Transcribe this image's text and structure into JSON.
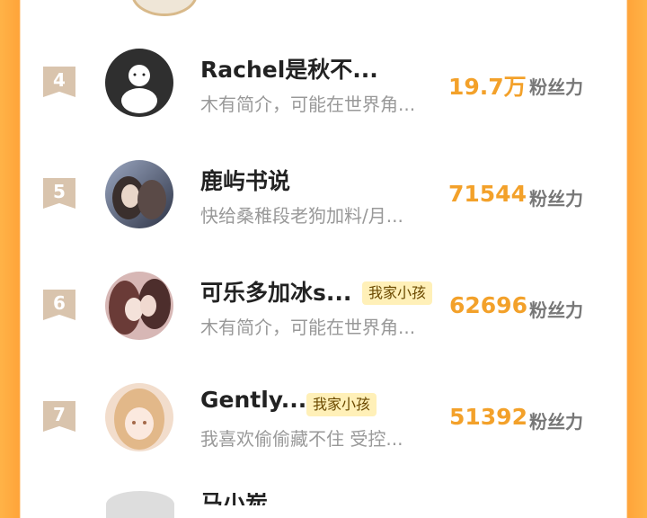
{
  "list": {
    "rows": [
      {
        "rank": "4",
        "name": "Rachel是秋不...",
        "tag": "",
        "desc": "木有简介，可能在世界角...",
        "count": "19.7万",
        "unit": "粉丝力"
      },
      {
        "rank": "5",
        "name": "鹿屿书说",
        "tag": "",
        "desc": "快给桑稚段老狗加料/月...",
        "count": "71544",
        "unit": "粉丝力"
      },
      {
        "rank": "6",
        "name": "可乐多加冰s...",
        "tag": "我家小孩",
        "desc": "木有简介，可能在世界角...",
        "count": "62696",
        "unit": "粉丝力"
      },
      {
        "rank": "7",
        "name": "Gently...",
        "tag": "我家小孩",
        "desc": "我喜欢偷偷藏不住 受控...",
        "count": "51392",
        "unit": "粉丝力"
      }
    ],
    "partial_row": {
      "name": "马小炭"
    }
  }
}
